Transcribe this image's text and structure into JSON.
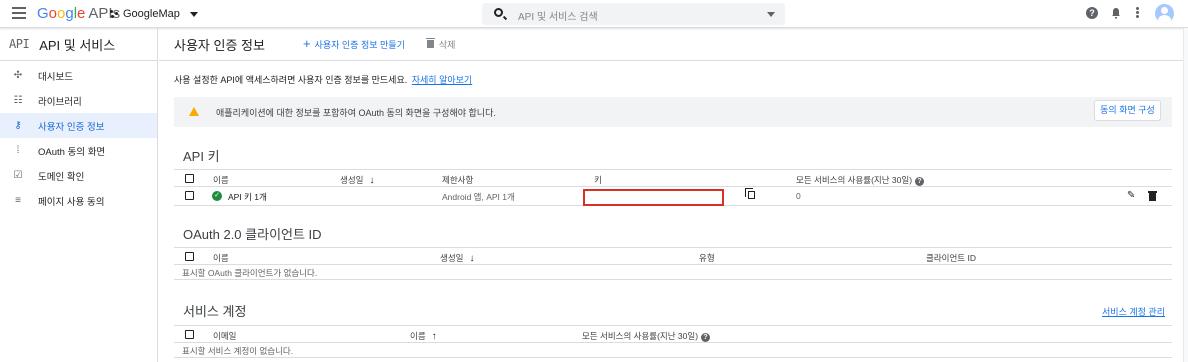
{
  "topbar": {
    "logo_letters": [
      "G",
      "o",
      "o",
      "g",
      "l",
      "e"
    ],
    "logo_suffix": "APIs",
    "project": "GoogleMap",
    "search_placeholder": "API 및 서비스 검색",
    "help_glyph": "?"
  },
  "sidebar": {
    "logo": "API",
    "title": "API 및 서비스",
    "items": [
      {
        "label": "대시보드",
        "icon": "dashboard-icon",
        "glyph": "✣",
        "active": false
      },
      {
        "label": "라이브러리",
        "icon": "library-icon",
        "glyph": "☷",
        "active": false
      },
      {
        "label": "사용자 인증 정보",
        "icon": "key-icon",
        "glyph": "⚷",
        "active": true
      },
      {
        "label": "OAuth 동의 화면",
        "icon": "oauth-consent-icon",
        "glyph": "⁞",
        "active": false
      },
      {
        "label": "도메인 확인",
        "icon": "domain-verify-icon",
        "glyph": "☑",
        "active": false
      },
      {
        "label": "페이지 사용 동의",
        "icon": "page-consent-icon",
        "glyph": "≡",
        "active": false
      }
    ]
  },
  "main": {
    "title": "사용자 인증 정보",
    "create_label": "사용자 인증 정보 만들기",
    "delete_label": "삭제",
    "intro_text": "사용 설정한 API에 액세스하려면 사용자 인증 정보를 만드세요.",
    "intro_link": "자세히 알아보기",
    "banner_text": "애플리케이션에 대한 정보를 포함하여 OAuth 동의 화면을 구성해야 합니다.",
    "banner_button": "동의 화면 구성"
  },
  "api_keys": {
    "title": "API 키",
    "columns": [
      "이름",
      "생성일",
      "제한사항",
      "키",
      "모든 서비스의 사용률(지난 30일)"
    ],
    "rows": [
      {
        "name": "API 키 1개",
        "created": "",
        "restrictions": "Android 앱, API 1개",
        "key": "",
        "usage": "0"
      }
    ]
  },
  "oauth": {
    "title": "OAuth 2.0 클라이언트 ID",
    "columns": [
      "이름",
      "생성일",
      "유형",
      "클라이언트 ID"
    ],
    "empty": "표시할 OAuth 클라이언트가 없습니다."
  },
  "service_accounts": {
    "title": "서비스 계정",
    "manage_link": "서비스 계정 관리",
    "columns": [
      "이메일",
      "이름",
      "모든 서비스의 사용률(지난 30일)"
    ],
    "empty": "표시할 서비스 계정이 없습니다."
  },
  "colors": {
    "accent": "#1a73e8",
    "active_bg": "#e8f0fe",
    "warning": "#f9ab00",
    "highlight": "#d93025",
    "success": "#1e8e3e"
  }
}
